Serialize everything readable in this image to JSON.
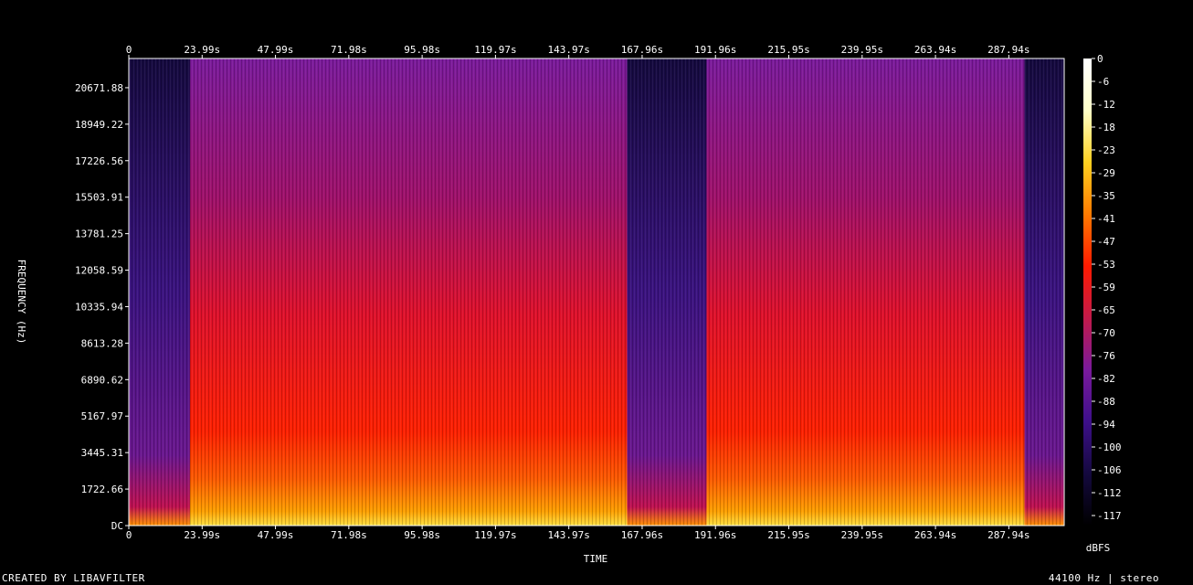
{
  "chart_data": {
    "type": "heatmap",
    "title": "",
    "xlabel": "TIME",
    "ylabel": "FREQUENCY (Hz)",
    "colorbar_label": "dBFS",
    "x_ticks": [
      "0",
      "23.99s",
      "47.99s",
      "71.98s",
      "95.98s",
      "119.97s",
      "143.97s",
      "167.96s",
      "191.96s",
      "215.95s",
      "239.95s",
      "263.94s",
      "287.94s"
    ],
    "y_ticks": [
      "DC",
      "1722.66",
      "3445.31",
      "5167.97",
      "6890.62",
      "8613.28",
      "10335.94",
      "12058.59",
      "13781.25",
      "15503.91",
      "17226.56",
      "18949.22",
      "20671.88"
    ],
    "colorbar_ticks": [
      "0",
      "-6",
      "-12",
      "-18",
      "-23",
      "-29",
      "-35",
      "-41",
      "-47",
      "-53",
      "-59",
      "-65",
      "-70",
      "-76",
      "-82",
      "-88",
      "-94",
      "-100",
      "-106",
      "-112",
      "-117"
    ],
    "x_range_s": [
      0,
      306
    ],
    "y_range_hz": [
      0,
      22050
    ],
    "segments": [
      {
        "start_s": 0,
        "end_s": 20,
        "level": "quiet"
      },
      {
        "start_s": 20,
        "end_s": 163,
        "level": "loud"
      },
      {
        "start_s": 163,
        "end_s": 189,
        "level": "quiet"
      },
      {
        "start_s": 189,
        "end_s": 293,
        "level": "loud"
      },
      {
        "start_s": 293,
        "end_s": 306,
        "level": "quiet"
      }
    ],
    "colormap": [
      "#000000",
      "#14093e",
      "#3d0f8a",
      "#7a1a9c",
      "#c21a4a",
      "#ff1a00",
      "#ff7a00",
      "#ffd020",
      "#ffffc8",
      "#ffffff"
    ]
  },
  "footer": {
    "left": "CREATED BY LIBAVFILTER",
    "right": "44100 Hz | stereo"
  }
}
